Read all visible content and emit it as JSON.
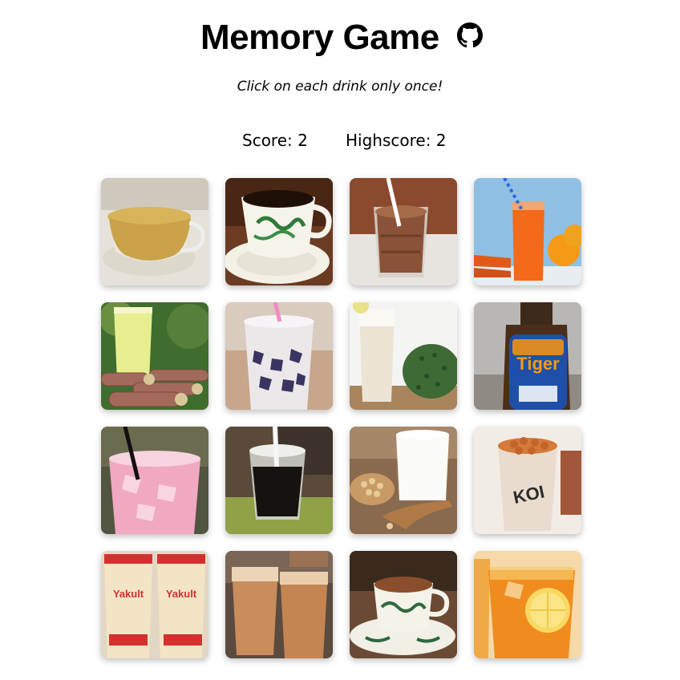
{
  "header": {
    "title": "Memory Game",
    "github_icon": "github-icon"
  },
  "subtitle": "Click on each drink only once!",
  "scoreboard": {
    "score_label": "Score: 2",
    "highscore_label": "Highscore: 2"
  },
  "cards": [
    {
      "drink": "green-tea"
    },
    {
      "drink": "kopi-black-coffee"
    },
    {
      "drink": "milo-chocolate"
    },
    {
      "drink": "carrot-orange-juice"
    },
    {
      "drink": "sugarcane-juice"
    },
    {
      "drink": "grass-jelly-milk"
    },
    {
      "drink": "soursop-juice"
    },
    {
      "drink": "tiger-beer",
      "label_text": "Tiger"
    },
    {
      "drink": "bandung-rose-milk"
    },
    {
      "drink": "iced-black-coffee"
    },
    {
      "drink": "soy-milk"
    },
    {
      "drink": "koi-bubble-tea",
      "label_text": "KOI"
    },
    {
      "drink": "yakult",
      "label_text": "Yakult"
    },
    {
      "drink": "teh-tarik"
    },
    {
      "drink": "kopi-with-milk"
    },
    {
      "drink": "iced-lemon-tea"
    }
  ]
}
